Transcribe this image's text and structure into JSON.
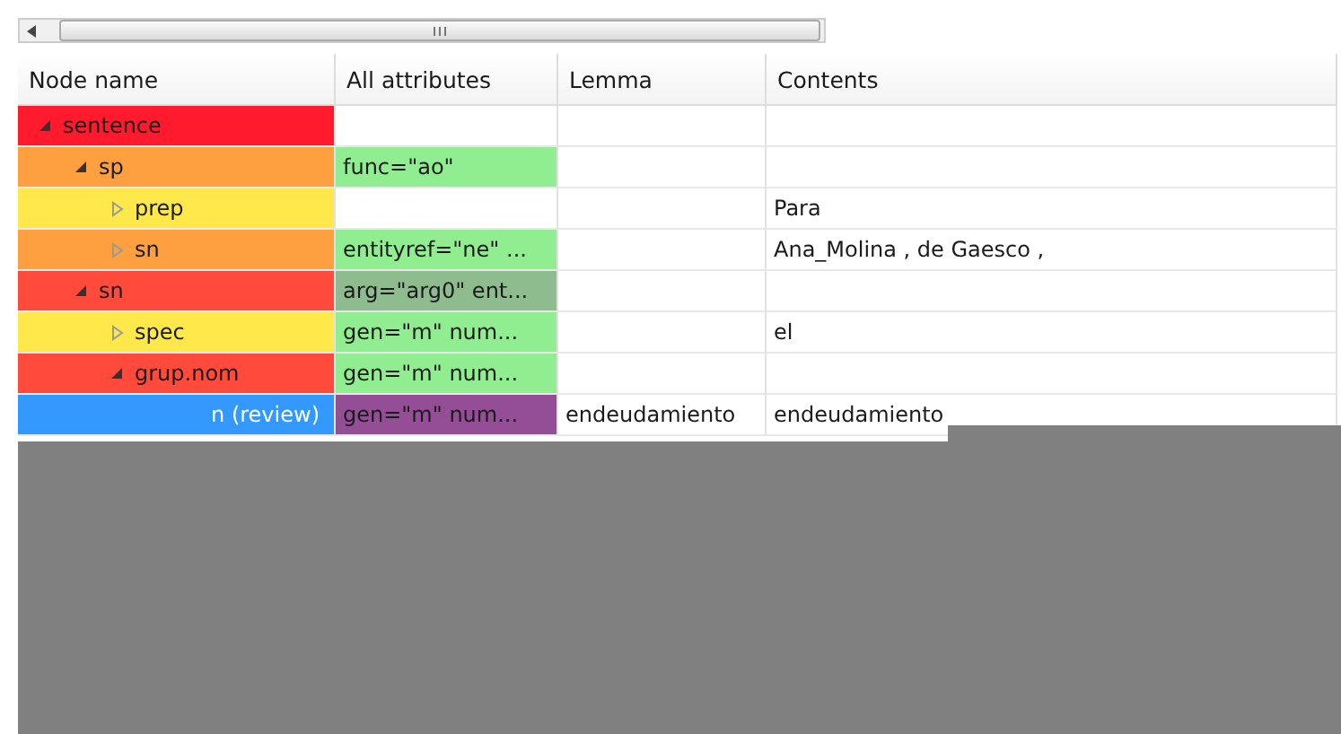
{
  "columns": [
    "Node name",
    "All attributes",
    "Lemma",
    "Contents"
  ],
  "tree": [
    {
      "name": "sentence",
      "expanded": true,
      "selected": false,
      "color": "#ff1a2e",
      "children": [
        {
          "name": "sp",
          "expanded": true,
          "selected": false,
          "color": "#ffa040",
          "attribute": {
            "text": "func=\"ao\"",
            "color": "#90ee90"
          },
          "children": [
            {
              "name": "prep",
              "expanded": false,
              "selected": false,
              "color": "#ffe94a",
              "contents": "Para"
            },
            {
              "name": "sn",
              "expanded": false,
              "selected": false,
              "color": "#ffa040",
              "attribute": {
                "text": "entityref=\"ne\" ...",
                "color": "#90ee90"
              },
              "contents": "Ana_Molina , de Gaesco ,"
            }
          ]
        },
        {
          "name": "sn",
          "expanded": true,
          "selected": false,
          "color": "#ff4a3c",
          "attribute": {
            "text": "arg=\"arg0\" ent...",
            "color": "#8fbc8f"
          },
          "children": [
            {
              "name": "spec",
              "expanded": false,
              "selected": false,
              "color": "#ffe94a",
              "attribute": {
                "text": "gen=\"m\" num...",
                "color": "#90ee90"
              },
              "contents": "el"
            },
            {
              "name": "grup.nom",
              "expanded": true,
              "selected": false,
              "color": "#ff4a3c",
              "attribute": {
                "text": "gen=\"m\" num...",
                "color": "#90ee90"
              },
              "children": [
                {
                  "name": "n (review)",
                  "selected": true,
                  "color": "#3399ff",
                  "attribute": {
                    "text": "gen=\"m\"  num...",
                    "color": "#944e96"
                  },
                  "lemma": "endeudamiento",
                  "contents": "endeudamiento"
                }
              ]
            }
          ]
        }
      ]
    }
  ]
}
